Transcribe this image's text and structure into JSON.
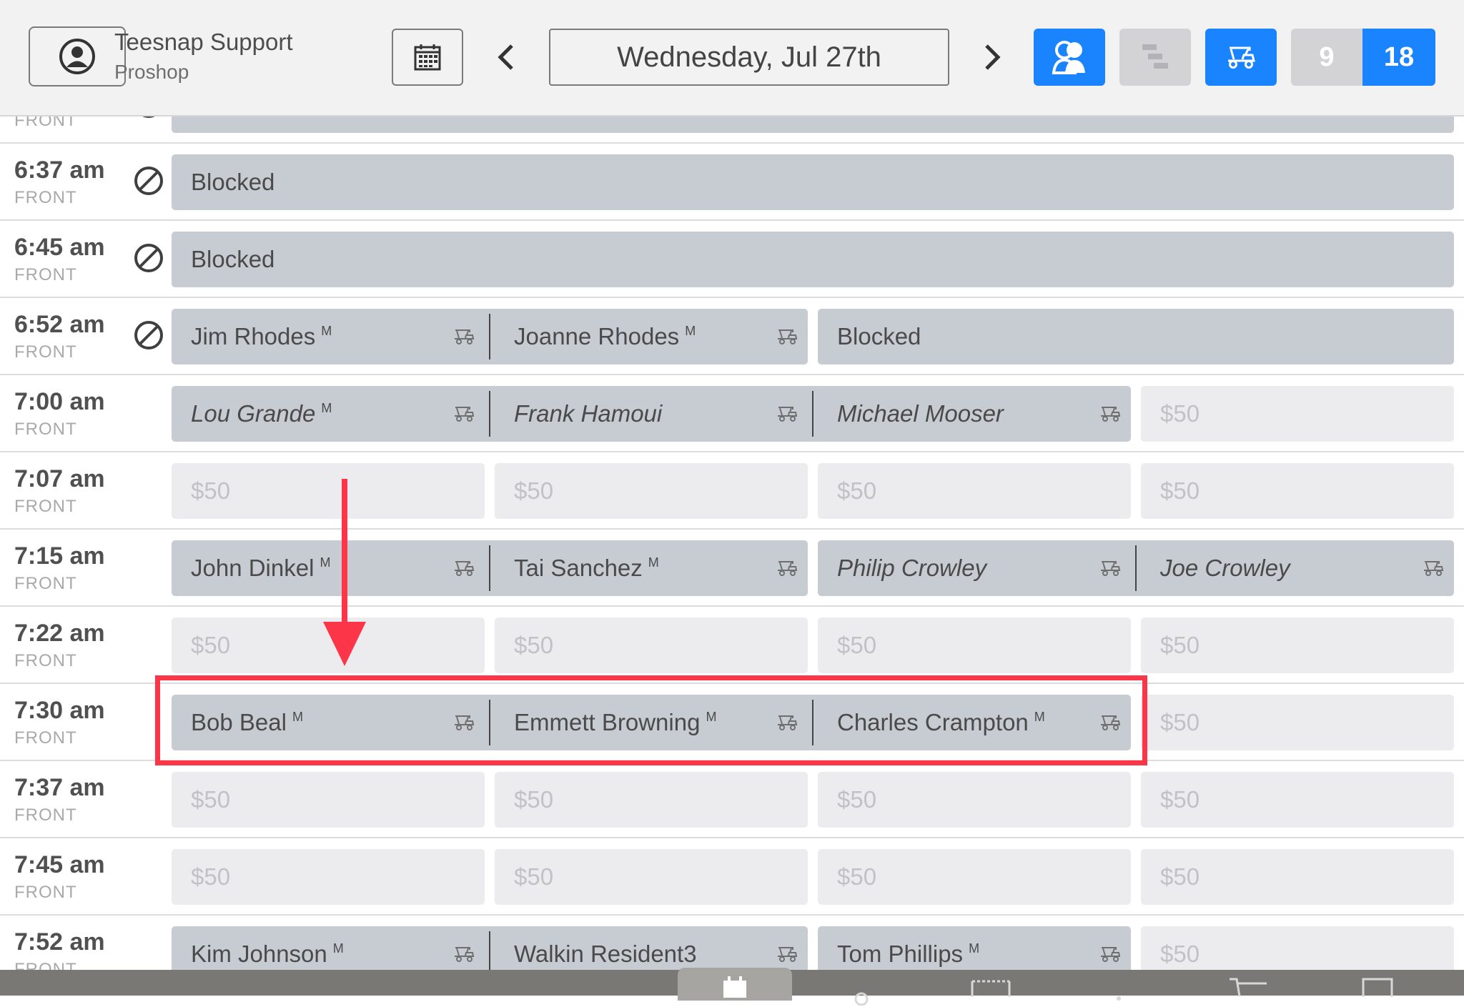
{
  "header": {
    "user_name": "Teesnap Support",
    "user_role": "Proshop",
    "date": "Wednesday, Jul 27th",
    "holes_9": "9",
    "holes_18": "18",
    "colors": {
      "accent": "#1a84ff",
      "annotation": "#fd3548"
    }
  },
  "rows": [
    {
      "time": "",
      "side": "FRONT",
      "blocked_icon": true,
      "slots": [
        {
          "type": "blocked",
          "text": ""
        }
      ]
    },
    {
      "time": "6:37 am",
      "side": "FRONT",
      "blocked_icon": true,
      "slots": [
        {
          "type": "blocked",
          "text": "Blocked"
        }
      ]
    },
    {
      "time": "6:45 am",
      "side": "FRONT",
      "blocked_icon": true,
      "slots": [
        {
          "type": "blocked",
          "text": "Blocked"
        }
      ]
    },
    {
      "time": "6:52 am",
      "side": "FRONT",
      "blocked_icon": true,
      "slots": [
        {
          "type": "player",
          "text": "Jim Rhodes",
          "member": "M"
        },
        {
          "type": "player",
          "text": "Joanne Rhodes",
          "member": "M"
        },
        {
          "type": "blocked",
          "text": "Blocked"
        }
      ]
    },
    {
      "time": "7:00 am",
      "side": "FRONT",
      "blocked_icon": false,
      "slots": [
        {
          "type": "player",
          "text": "Lou Grande",
          "member": "M",
          "guest": true
        },
        {
          "type": "player",
          "text": "Frank Hamoui",
          "guest": true
        },
        {
          "type": "player",
          "text": "Michael Mooser",
          "guest": true
        },
        {
          "type": "empty",
          "text": "$50"
        }
      ]
    },
    {
      "time": "7:07 am",
      "side": "FRONT",
      "blocked_icon": false,
      "slots": [
        {
          "type": "empty",
          "text": "$50"
        },
        {
          "type": "empty",
          "text": "$50"
        },
        {
          "type": "empty",
          "text": "$50"
        },
        {
          "type": "empty",
          "text": "$50"
        }
      ]
    },
    {
      "time": "7:15 am",
      "side": "FRONT",
      "blocked_icon": false,
      "slots": [
        {
          "type": "player",
          "text": "John Dinkel",
          "member": "M"
        },
        {
          "type": "player",
          "text": "Tai  Sanchez",
          "member": "M"
        },
        {
          "type": "player",
          "text": "Philip Crowley",
          "guest": true
        },
        {
          "type": "player",
          "text": "Joe Crowley",
          "guest": true
        }
      ]
    },
    {
      "time": "7:22 am",
      "side": "FRONT",
      "blocked_icon": false,
      "slots": [
        {
          "type": "empty",
          "text": "$50"
        },
        {
          "type": "empty",
          "text": "$50"
        },
        {
          "type": "empty",
          "text": "$50"
        },
        {
          "type": "empty",
          "text": "$50"
        }
      ]
    },
    {
      "time": "7:30 am",
      "side": "FRONT",
      "blocked_icon": false,
      "slots": [
        {
          "type": "player",
          "text": "Bob Beal",
          "member": "M"
        },
        {
          "type": "player",
          "text": "Emmett Browning",
          "member": "M"
        },
        {
          "type": "player",
          "text": "Charles Crampton",
          "member": "M"
        },
        {
          "type": "empty",
          "text": "$50"
        }
      ]
    },
    {
      "time": "7:37 am",
      "side": "FRONT",
      "blocked_icon": false,
      "slots": [
        {
          "type": "empty",
          "text": "$50"
        },
        {
          "type": "empty",
          "text": "$50"
        },
        {
          "type": "empty",
          "text": "$50"
        },
        {
          "type": "empty",
          "text": "$50"
        }
      ]
    },
    {
      "time": "7:45 am",
      "side": "FRONT",
      "blocked_icon": false,
      "slots": [
        {
          "type": "empty",
          "text": "$50"
        },
        {
          "type": "empty",
          "text": "$50"
        },
        {
          "type": "empty",
          "text": "$50"
        },
        {
          "type": "empty",
          "text": "$50"
        }
      ]
    },
    {
      "time": "7:52 am",
      "side": "FRONT",
      "blocked_icon": false,
      "slots": [
        {
          "type": "player",
          "text": "Kim Johnson",
          "member": "M"
        },
        {
          "type": "player",
          "text": "Walkin Resident3"
        },
        {
          "type": "player",
          "text": "Tom Phillips",
          "member": "M"
        },
        {
          "type": "empty",
          "text": "$50"
        }
      ]
    }
  ],
  "icons": {
    "user": "user-circle-icon",
    "calendar": "calendar-icon",
    "prev": "chevron-left-icon",
    "next": "chevron-right-icon",
    "players_view": "players-icon",
    "timeline_view": "timeline-icon",
    "cart_view": "golf-cart-icon",
    "blocked": "blocked-icon",
    "cart": "golf-cart-icon"
  }
}
